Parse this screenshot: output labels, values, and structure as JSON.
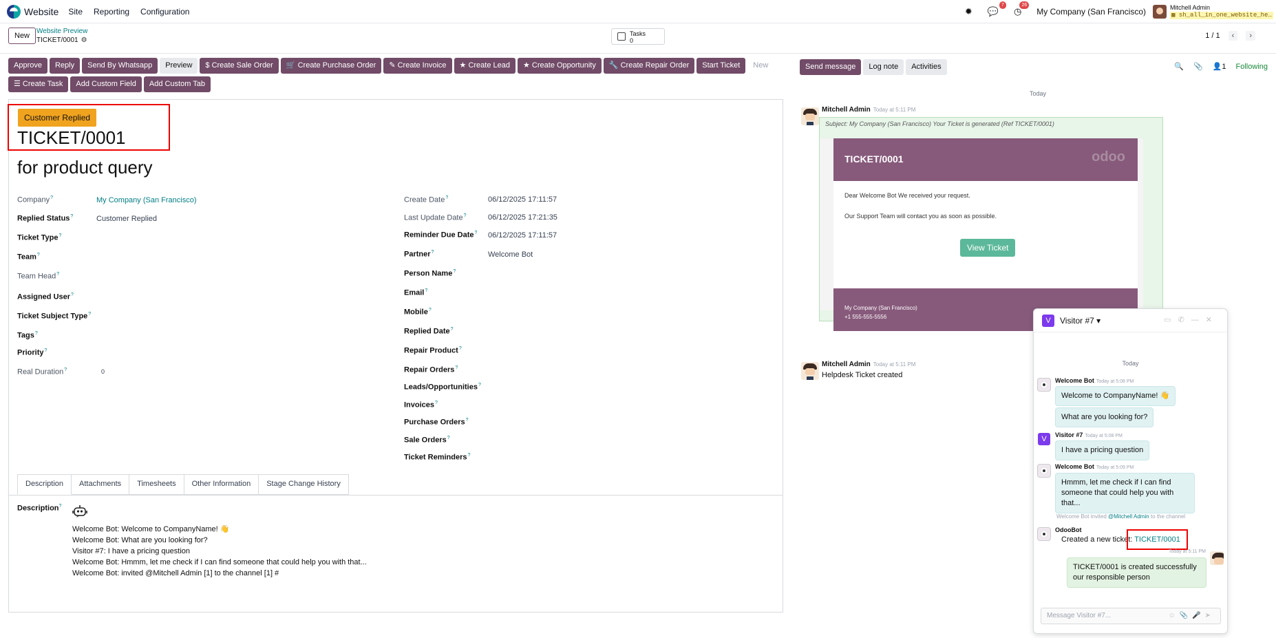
{
  "topbar": {
    "app": "Website",
    "menu": [
      "Site",
      "Reporting",
      "Configuration"
    ],
    "badge_messages": "7",
    "badge_activities": "26",
    "company": "My Company (San Francisco)",
    "user": "Mitchell Admin",
    "db": "sh_all_in_one_website_he…"
  },
  "control": {
    "new_label": "New",
    "breadcrumb_parent": "Website Preview",
    "breadcrumb_current": "TICKET/0001",
    "tasks_label": "Tasks",
    "tasks_count": "0",
    "pager": "1 / 1"
  },
  "actions": {
    "row1": [
      "Approve",
      "Reply",
      "Send By Whatsapp",
      "Preview",
      "$ Create Sale Order",
      "🛒 Create Purchase Order",
      "✎ Create Invoice",
      "★ Create Lead",
      "★ Create Opportunity",
      "🔧 Create Repair Order",
      "Start Ticket",
      "New"
    ],
    "row2": [
      "☰ Create Task",
      "Add Custom Field",
      "Add Custom Tab"
    ]
  },
  "form": {
    "stage": "Customer Replied",
    "name": "TICKET/0001",
    "subject": "for product query",
    "left_labels": [
      "Company",
      "Replied Status",
      "Ticket Type",
      "Team",
      "Team Head",
      "Assigned User",
      "Ticket Subject Type",
      "Tags",
      "Priority",
      "Real Duration"
    ],
    "company_value": "My Company (San Francisco)",
    "replied_status_value": "Customer Replied",
    "real_duration_value": "0",
    "right_labels": [
      "Create Date",
      "Last Update Date",
      "Reminder Due Date",
      "Partner",
      "Person Name",
      "Email",
      "Mobile",
      "Replied Date",
      "Repair Product",
      "Repair Orders",
      "Leads/Opportunities",
      "Invoices",
      "Purchase Orders",
      "Sale Orders",
      "Ticket Reminders"
    ],
    "create_date": "06/12/2025 17:11:57",
    "last_update_date": "06/12/2025 17:21:35",
    "reminder_due_date": "06/12/2025 17:11:57",
    "partner": "Welcome Bot",
    "tabs": [
      "Description",
      "Attachments",
      "Timesheets",
      "Other Information",
      "Stage Change History"
    ],
    "description_label": "Description",
    "description_lines": [
      "Welcome Bot: Welcome to CompanyName! 👋",
      "Welcome Bot: What are you looking for?",
      "Visitor #7: I have a pricing question",
      "Welcome Bot: Hmmm, let me check if I can find someone that could help you with that...",
      "Welcome Bot: invited @Mitchell Admin [1] to the channel [1] #"
    ]
  },
  "chatter": {
    "send_message": "Send message",
    "log_note": "Log note",
    "activities": "Activities",
    "followers_count": "1",
    "following": "Following",
    "today": "Today",
    "msg1_author": "Mitchell Admin",
    "msg1_time": "Today at 5:11 PM",
    "msg1_subject": "Subject: My Company (San Francisco) Your Ticket is generated (Ref TICKET/0001)",
    "mail_title": "TICKET/0001",
    "mail_logo": "odoo",
    "mail_line1": "Dear Welcome Bot We received your request.",
    "mail_line2": "Our Support Team will contact you as soon as possible.",
    "mail_button": "View Ticket",
    "mail_company": "My Company (San Francisco)",
    "mail_phone": "+1 555-555-5556",
    "msg2_author": "Mitchell Admin",
    "msg2_time": "Today at 5:11 PM",
    "msg2_body": "Helpdesk Ticket created"
  },
  "livechat": {
    "title": "Visitor #7",
    "today": "Today",
    "wb1_name": "Welcome Bot",
    "wb1_time": "Today at 5:08 PM",
    "wb1_msg1": "Welcome to CompanyName! 👋",
    "wb1_msg2": "What are you looking for?",
    "v_name": "Visitor #7",
    "v_time": "Today at 5:08 PM",
    "v_msg": "I have a pricing question",
    "wb2_name": "Welcome Bot",
    "wb2_time": "Today at 5:09 PM",
    "wb2_msg": "Hmmm, let me check if I can find someone that could help you with that...",
    "invited_note_pre": "Welcome Bot invited ",
    "invited_note_link": "@Mitchell Admin",
    "invited_note_post": " to the channel",
    "ob_name": "OdooBot",
    "ob_msg": "Created a new ticket: ",
    "ob_link": "TICKET/0001",
    "me_time": "Today at 5:11 PM",
    "me_msg": "TICKET/0001 is created successfully our responsible person",
    "placeholder": "Message Visitor #7..."
  }
}
